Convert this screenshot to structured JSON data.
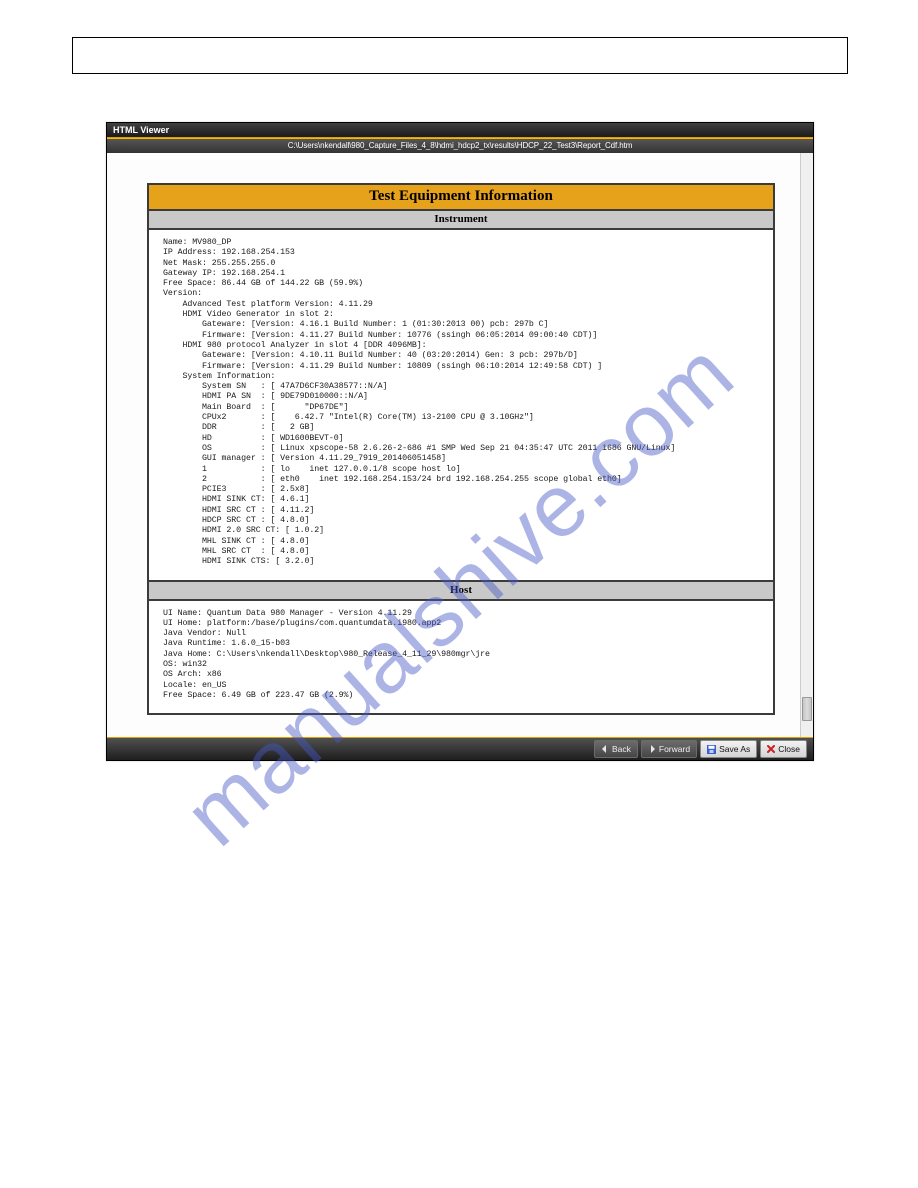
{
  "top_box_text": "",
  "viewer": {
    "title": "HTML Viewer",
    "path": "C:\\Users\\nkendall\\980_Capture_Files_4_8\\hdmi_hdcp2_tx\\results\\HDCP_22_Test3\\Report_Cdf.htm",
    "report": {
      "title": "Test Equipment Information",
      "instrument_label": "Instrument",
      "instrument_body": "Name: MV980_DP\nIP Address: 192.168.254.153\nNet Mask: 255.255.255.0\nGateway IP: 192.168.254.1\nFree Space: 86.44 GB of 144.22 GB (59.9%)\nVersion:\n    Advanced Test platform Version: 4.11.29\n    HDMI Video Generator in slot 2:\n        Gateware: [Version: 4.16.1 Build Number: 1 (01:30:2013 00) pcb: 297b C]\n        Firmware: [Version: 4.11.27 Build Number: 10776 (ssingh 06:05:2014 09:00:40 CDT)]\n    HDMI 980 protocol Analyzer in slot 4 [DDR 4096MB]:\n        Gateware: [Version: 4.10.11 Build Number: 40 (03:20:2014) Gen: 3 pcb: 297b/D]\n        Firmware: [Version: 4.11.29 Build Number: 10809 (ssingh 06:10:2014 12:49:58 CDT) ]\n    System Information:\n        System SN   : [ 47A7D6CF30A38577::N/A]\n        HDMI PA SN  : [ 9DE79D010000::N/A]\n        Main Board  : [      \"DP67DE\"]\n        CPUx2       : [    6.42.7 \"Intel(R) Core(TM) i3-2100 CPU @ 3.10GHz\"]\n        DDR         : [   2 GB]\n        HD          : [ WD1600BEVT-0]\n        OS          : [ Linux xpscope-58 2.6.26-2-686 #1 SMP Wed Sep 21 04:35:47 UTC 2011 i686 GNU/Linux]\n        GUI manager : [ Version 4.11.29_7919_201406051458]\n        1           : [ lo    inet 127.0.0.1/8 scope host lo]\n        2           : [ eth0    inet 192.168.254.153/24 brd 192.168.254.255 scope global eth0]\n        PCIE3       : [ 2.5x8]\n        HDMI SINK CT: [ 4.6.1]\n        HDMI SRC CT : [ 4.11.2]\n        HDCP SRC CT : [ 4.8.0]\n        HDMI 2.0 SRC CT: [ 1.0.2]\n        MHL SINK CT : [ 4.8.0]\n        MHL SRC CT  : [ 4.8.0]\n        HDMI SINK CTS: [ 3.2.0]",
      "host_label": "Host",
      "host_body": "UI Name: Quantum Data 980 Manager - Version 4.11.29\nUI Home: platform:/base/plugins/com.quantumdata.i980.app2\nJava Vendor: Null\nJava Runtime: 1.6.0_15-b03\nJava Home: C:\\Users\\nkendall\\Desktop\\980_Release_4_11_29\\980mgr\\jre\nOS: win32\nOS Arch: x86\nLocale: en_US\nFree Space: 6.49 GB of 223.47 GB (2.9%)"
    },
    "buttons": {
      "back": "Back",
      "forward": "Forward",
      "save_as": "Save As",
      "close": "Close"
    }
  },
  "watermark": "manualshive.com"
}
